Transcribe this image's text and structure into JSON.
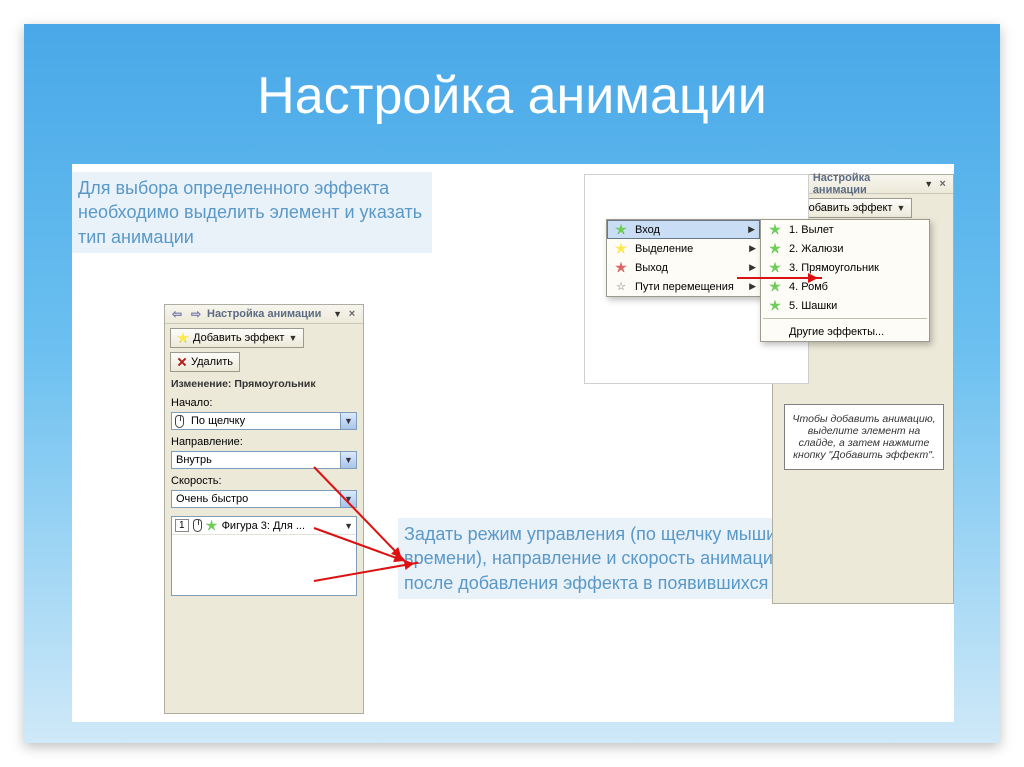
{
  "slide": {
    "title": "Настройка анимации",
    "note1": "Для выбора определенного эффекта необходимо выделить элемент и указать тип анимации",
    "note2": "Задать режим управления (по щелчку мыши или по времени), направление и скорость анимации можно после добавления эффекта в появившихся окнах"
  },
  "panel": {
    "title": "Настройка анимации",
    "add_effect": "Добавить эффект",
    "delete": "Удалить",
    "change_header": "Изменение: Прямоугольник",
    "start_label": "Начало:",
    "start_value": "По щелчку",
    "direction_label": "Направление:",
    "direction_value": "Внутрь",
    "speed_label": "Скорость:",
    "speed_value": "Очень быстро",
    "item_num": "1",
    "item_label": "Фигура 3: Для ...",
    "hint": "Чтобы добавить анимацию, выделите элемент на слайде, а затем нажмите кнопку \"Добавить эффект\".",
    "speed_prefix": "Скор"
  },
  "menu": {
    "add_effect": "Добавить эффект",
    "entry": "Вход",
    "emphasis": "Выделение",
    "exit": "Выход",
    "motion": "Пути перемещения",
    "sub": {
      "i1": "1. Вылет",
      "i2": "2. Жалюзи",
      "i3": "3. Прямоугольник",
      "i4": "4. Ромб",
      "i5": "5. Шашки",
      "more": "Другие эффекты..."
    }
  }
}
